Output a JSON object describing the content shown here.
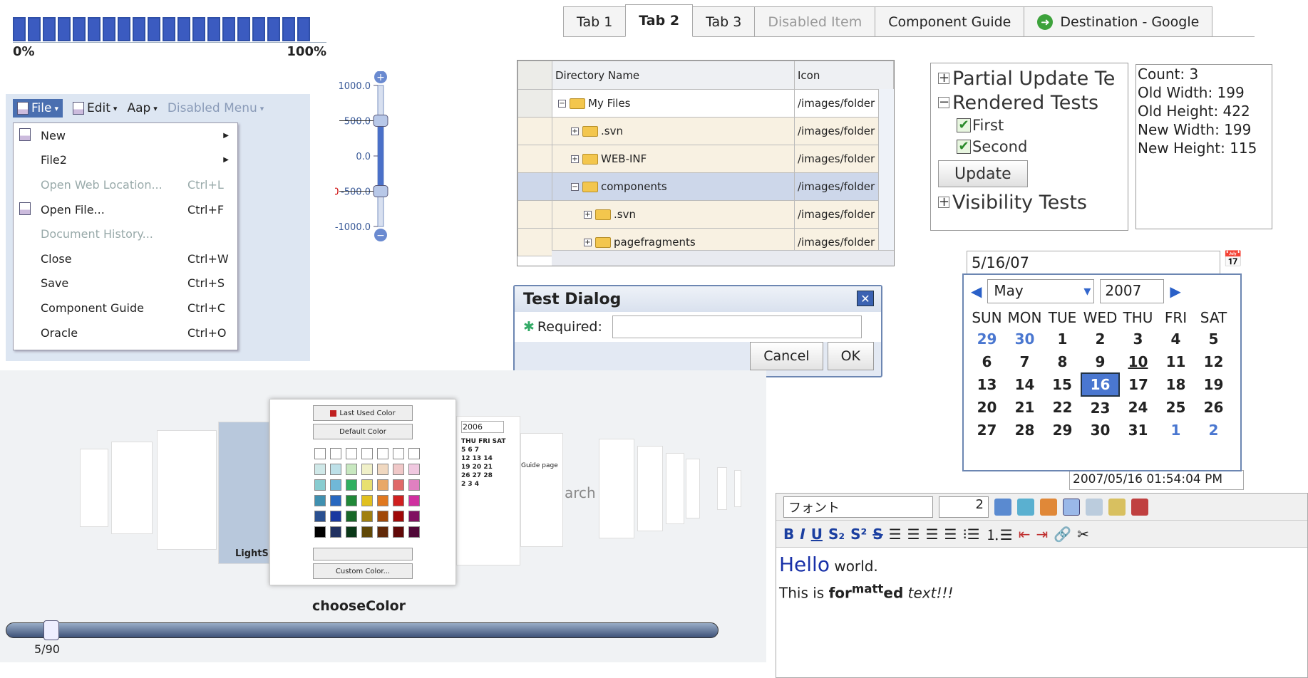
{
  "progress": {
    "start_label": "0%",
    "end_label": "100%",
    "segments": 20,
    "filled": 20
  },
  "menubar": {
    "items": [
      {
        "label": "File",
        "state": "selected"
      },
      {
        "label": "Edit",
        "state": "normal"
      },
      {
        "label": "Aap",
        "state": "normal"
      },
      {
        "label": "Disabled Menu",
        "state": "disabled"
      }
    ]
  },
  "file_menu": {
    "items": [
      {
        "label": "New",
        "accel": "",
        "submenu": true,
        "disabled": false,
        "icon": "doc-icon"
      },
      {
        "label": "File2",
        "accel": "",
        "submenu": true,
        "disabled": false,
        "icon": ""
      },
      {
        "label": "Open Web Location...",
        "accel": "Ctrl+L",
        "submenu": false,
        "disabled": true,
        "icon": ""
      },
      {
        "label": "Open File...",
        "accel": "Ctrl+F",
        "submenu": false,
        "disabled": false,
        "icon": "doc-icon"
      },
      {
        "label": "Document History...",
        "accel": "",
        "submenu": false,
        "disabled": true,
        "icon": ""
      },
      {
        "label": "Close",
        "accel": "Ctrl+W",
        "submenu": false,
        "disabled": false,
        "icon": ""
      },
      {
        "label": "Save",
        "accel": "Ctrl+S",
        "submenu": false,
        "disabled": false,
        "icon": ""
      },
      {
        "label": "Component Guide",
        "accel": "Ctrl+C",
        "submenu": false,
        "disabled": false,
        "icon": ""
      },
      {
        "label": "Oracle",
        "accel": "Ctrl+O",
        "submenu": false,
        "disabled": false,
        "icon": ""
      }
    ]
  },
  "vslider": {
    "ticks": [
      "1000.0",
      "500.0",
      "0.0",
      "-500.0",
      "-1000.0"
    ],
    "upper_marker": "500",
    "lower_marker": "-500",
    "upper_value": 500,
    "lower_value": -500,
    "min": -1000,
    "max": 1000
  },
  "tabs": {
    "items": [
      {
        "label": "Tab 1",
        "state": "normal"
      },
      {
        "label": "Tab 2",
        "state": "active"
      },
      {
        "label": "Tab 3",
        "state": "normal"
      },
      {
        "label": "Disabled Item",
        "state": "disabled"
      },
      {
        "label": "Component Guide",
        "state": "normal"
      },
      {
        "label": "Destination - Google",
        "state": "normal",
        "icon": "google-icon"
      }
    ]
  },
  "directory_table": {
    "headers": [
      "Directory Name",
      "Icon"
    ],
    "rows": [
      {
        "name": "My Files",
        "icon": "/images/folder",
        "toggle": "−",
        "indent": 0,
        "style": "plain"
      },
      {
        "name": ".svn",
        "icon": "/images/folder",
        "toggle": "+",
        "indent": 1,
        "style": "alt"
      },
      {
        "name": "WEB-INF",
        "icon": "/images/folder",
        "toggle": "+",
        "indent": 1,
        "style": "alt"
      },
      {
        "name": "components",
        "icon": "/images/folder",
        "toggle": "−",
        "indent": 1,
        "style": "sel"
      },
      {
        "name": ".svn",
        "icon": "/images/folder",
        "toggle": "+",
        "indent": 2,
        "style": "alt"
      },
      {
        "name": "pagefragments",
        "icon": "/images/folder",
        "toggle": "+",
        "indent": 2,
        "style": "alt"
      }
    ]
  },
  "dialog": {
    "title": "Test Dialog",
    "required_label": "Required:",
    "cancel": "Cancel",
    "ok": "OK"
  },
  "tree": {
    "partial": "Partial Update Te",
    "rendered": "Rendered Tests",
    "first": "First",
    "second": "Second",
    "update": "Update",
    "visibility": "Visibility Tests"
  },
  "stats": {
    "count": "Count: 3",
    "old_width": "Old Width: 199",
    "old_height": "Old Height: 422",
    "new_width": "New Width: 199",
    "new_height": "New Height: 115"
  },
  "date": {
    "value": "5/16/07",
    "month": "May",
    "year": "2007",
    "weekdays": [
      "SUN",
      "MON",
      "TUE",
      "WED",
      "THU",
      "FRI",
      "SAT"
    ],
    "weeks": [
      [
        "29",
        "30",
        "1",
        "2",
        "3",
        "4",
        "5"
      ],
      [
        "6",
        "7",
        "8",
        "9",
        "10",
        "11",
        "12"
      ],
      [
        "13",
        "14",
        "15",
        "16",
        "17",
        "18",
        "19"
      ],
      [
        "20",
        "21",
        "22",
        "23",
        "24",
        "25",
        "26"
      ],
      [
        "27",
        "28",
        "29",
        "30",
        "31",
        "1",
        "2"
      ]
    ],
    "behind_text": "2007/05/16 01:54:04 PM"
  },
  "editor": {
    "font_label": "フォント",
    "size": "2",
    "line1_big": "Hello",
    "line1_rest": " world.",
    "line2_a": "This is ",
    "line2_b": "for",
    "line2_sup": "matt",
    "line2_c": "ed",
    "line2_d": " text!!!"
  },
  "carousel": {
    "caption": "chooseColor",
    "left_caption": "LightS",
    "last_used": "Last Used Color",
    "default": "Default Color",
    "custom": "Custom Color...",
    "counter": "5/90",
    "year": "2006",
    "guide": "Guide page",
    "search_frag": "arch",
    "cal_mini": [
      "THU FRI SAT",
      "5 6 7",
      "12 13 14",
      "19 20 21",
      "26 27 28",
      "2 3 4"
    ],
    "colors": [
      "#fff",
      "#fff",
      "#fff",
      "#fff",
      "#fff",
      "#fff",
      "#fff",
      "#cfe8e8",
      "#bde0e8",
      "#c8e8c0",
      "#f0f0c8",
      "#f0d8c0",
      "#f0c8c8",
      "#f0c8e0",
      "#88ccd0",
      "#70b8d8",
      "#30b060",
      "#e8e070",
      "#e8a868",
      "#e06868",
      "#e080c0",
      "#4090b0",
      "#2868c0",
      "#208838",
      "#e0c020",
      "#e07820",
      "#d02020",
      "#d030a0",
      "#2a5090",
      "#1838a0",
      "#186828",
      "#a08010",
      "#a04808",
      "#a00808",
      "#801060",
      "#000",
      "#203060",
      "#0a3818",
      "#604808",
      "#602808",
      "#600808",
      "#500838"
    ]
  }
}
